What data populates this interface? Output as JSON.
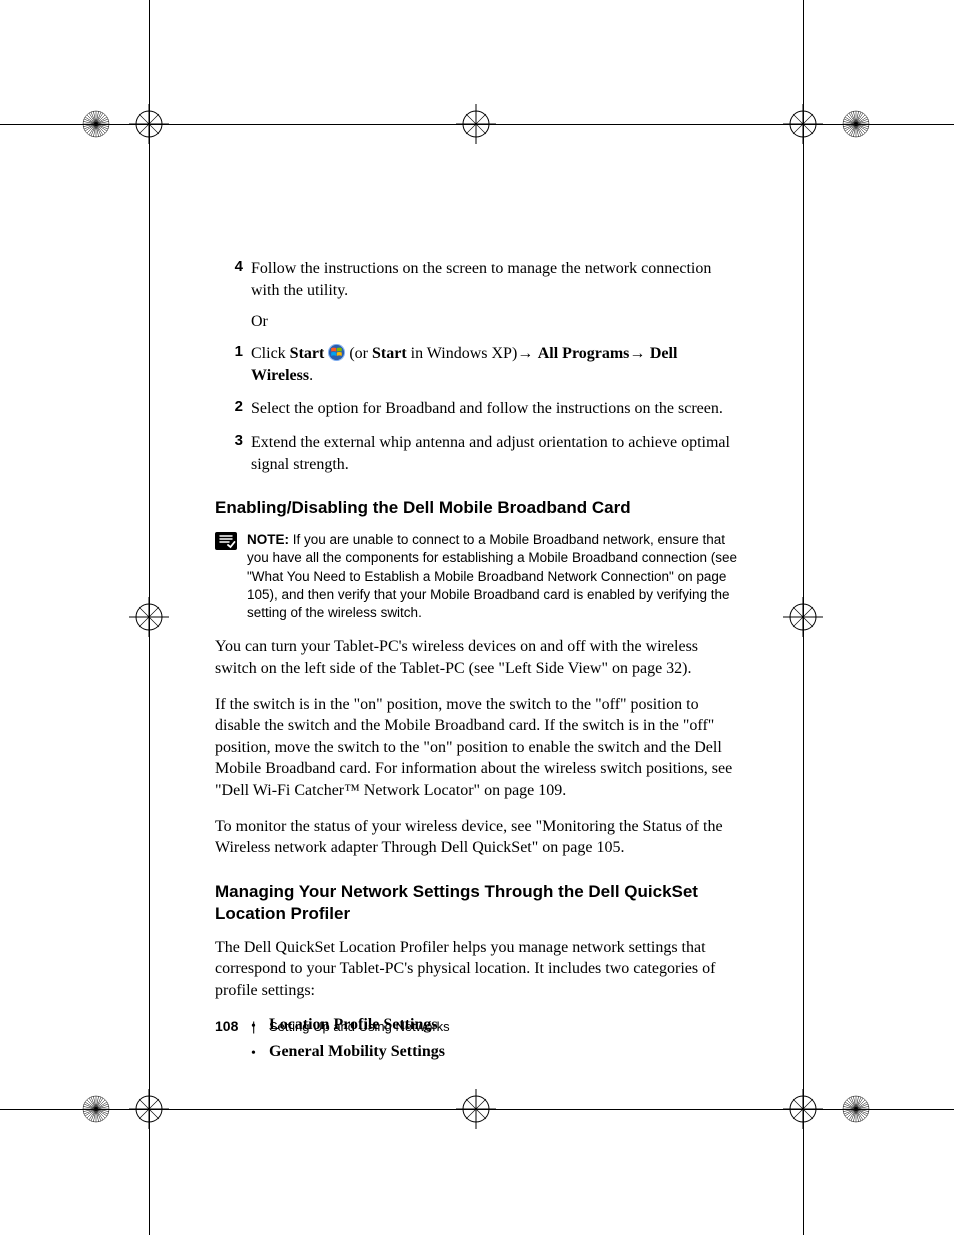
{
  "steps_top": {
    "item4": {
      "num": "4",
      "text": "Follow the instructions on the screen to manage the network connection with the utility."
    },
    "or": "Or",
    "item1": {
      "num": "1",
      "click": "Click ",
      "start": "Start ",
      "paren_pre": " (or ",
      "start2": "Start",
      "paren_post": " in Windows XP)",
      "arrow": "→ ",
      "allprog": "All Programs",
      "arrow2": "→ ",
      "dellw": "Dell Wireless",
      "period": "."
    },
    "item2": {
      "num": "2",
      "text": "Select the option for Broadband and follow the instructions on the screen."
    },
    "item3": {
      "num": "3",
      "text": "Extend the external whip antenna and adjust orientation to achieve optimal signal strength."
    }
  },
  "heading1": "Enabling/Disabling the Dell Mobile Broadband Card",
  "note": {
    "label": "NOTE: ",
    "text": "If you are unable to connect to a Mobile Broadband network, ensure that you have all the components for establishing a Mobile Broadband connection (see \"What You Need to Establish a Mobile Broadband Network Connection\" on page 105), and then verify that your Mobile Broadband card is enabled by verifying the setting of the wireless switch."
  },
  "para1": "You can turn your Tablet-PC's wireless devices on and off with the wireless switch on the left side of the Tablet-PC (see \"Left Side View\" on page 32).",
  "para2": "If the switch is in the \"on\" position, move the switch to the \"off\" position to disable the switch and the Mobile Broadband card. If the switch is in the \"off\" position, move the switch to the \"on\" position to enable the switch and the Dell Mobile Broadband card. For information about the wireless switch positions, see \"Dell Wi-Fi Catcher™ Network Locator\" on page 109.",
  "para3": "To monitor the status of your wireless device, see \"Monitoring the Status of the Wireless network adapter Through Dell QuickSet\" on page 105.",
  "heading2": "Managing Your Network Settings Through the Dell QuickSet Location Profiler",
  "para4": "The Dell QuickSet Location Profiler helps you manage network settings that correspond to your Tablet-PC's physical location. It includes two categories of profile settings:",
  "bullets": {
    "b1": "Location Profile Settings",
    "b2": "General Mobility Settings"
  },
  "footer": {
    "page": "108",
    "section": "Setting Up and Using Networks",
    "sep": "|"
  }
}
